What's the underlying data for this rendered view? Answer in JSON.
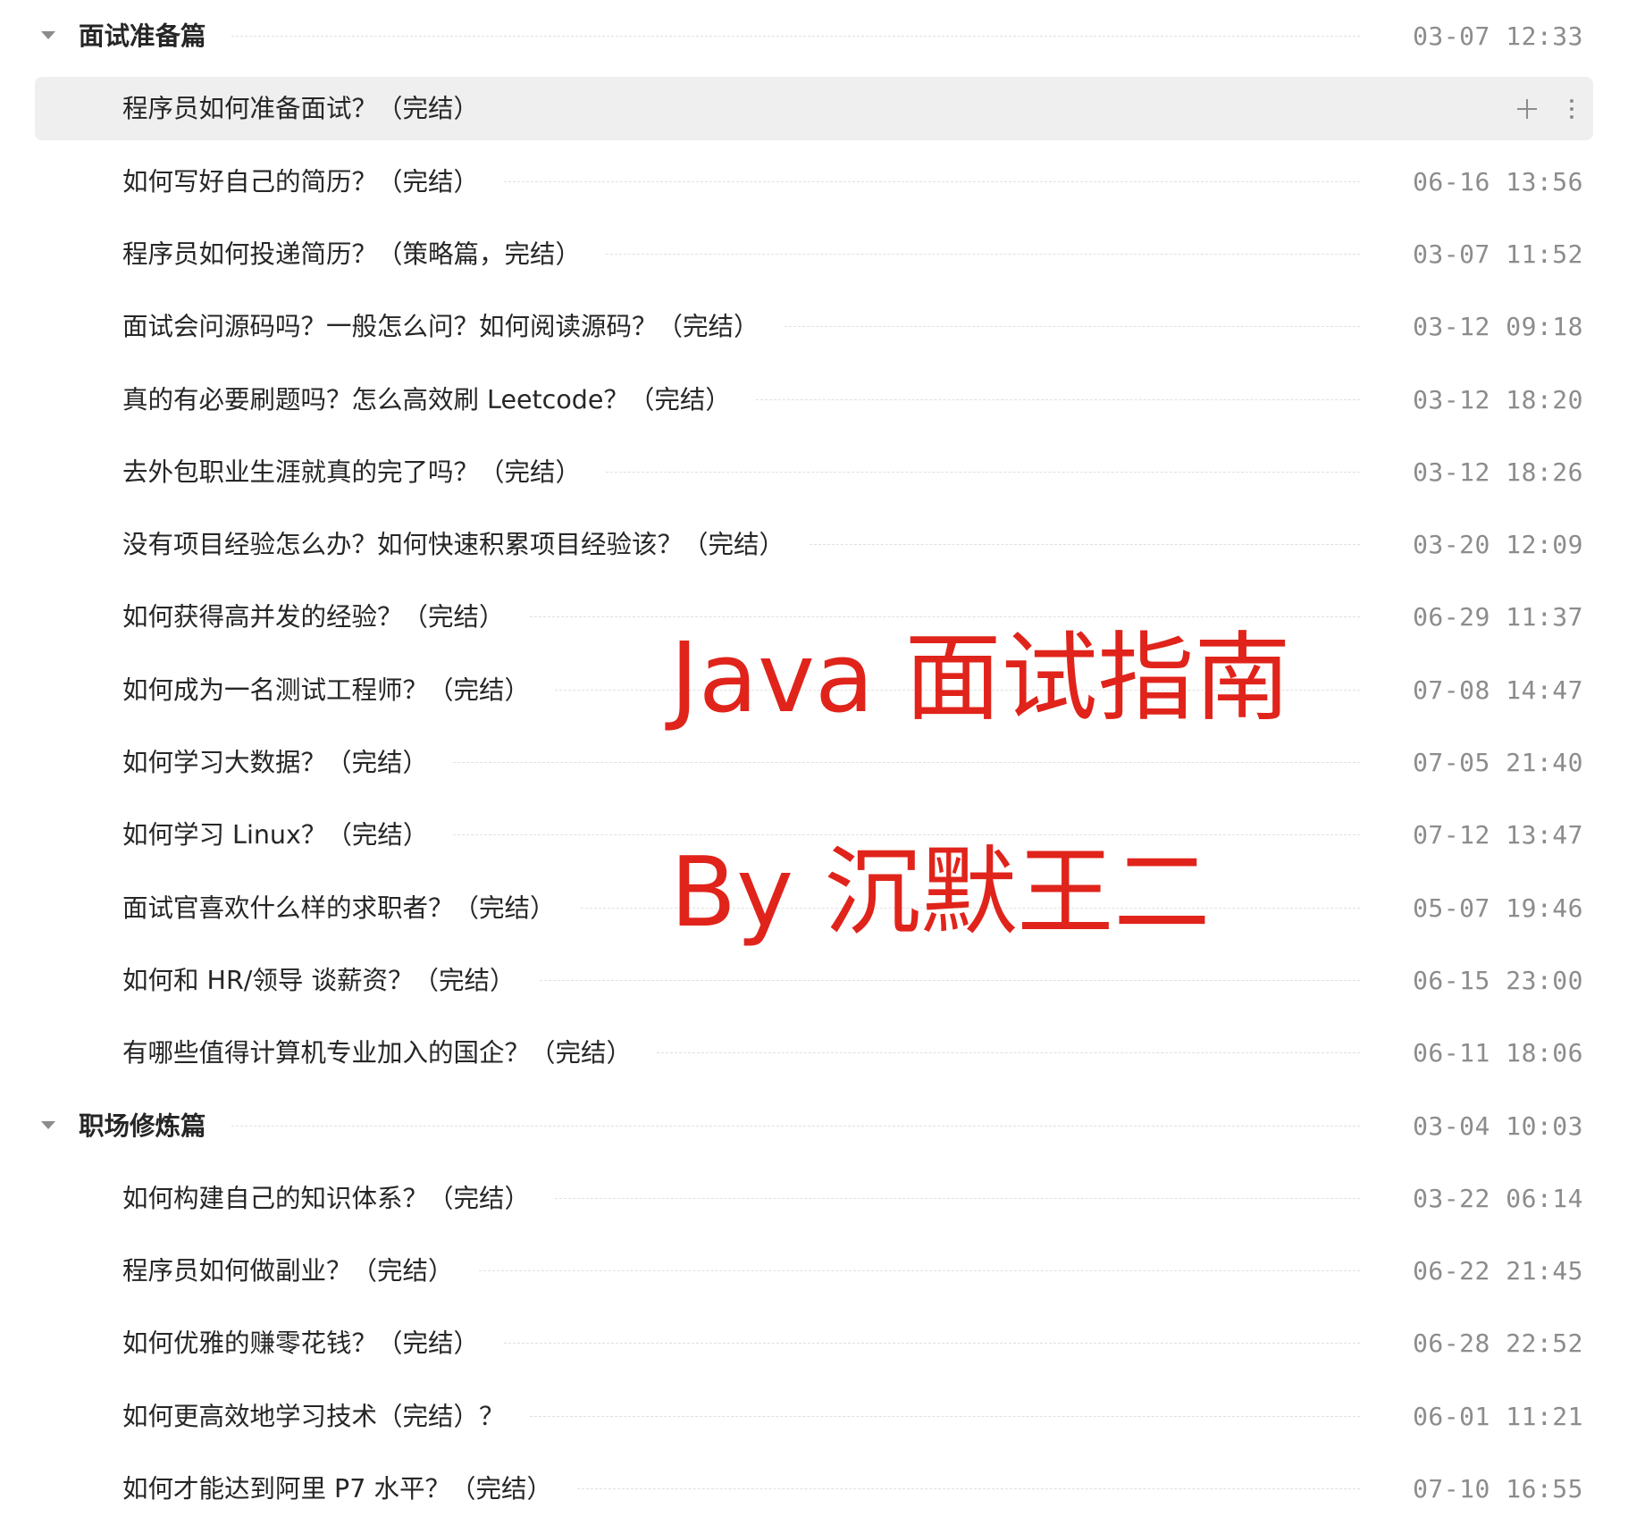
{
  "rows": [
    {
      "type": "section",
      "title": "面试准备篇",
      "date": "03-07 12:33"
    },
    {
      "type": "item",
      "title": "程序员如何准备面试？（完结）",
      "date": "",
      "highlight": true
    },
    {
      "type": "item",
      "title": "如何写好自己的简历？（完结）",
      "date": "06-16 13:56"
    },
    {
      "type": "item",
      "title": "程序员如何投递简历？（策略篇，完结）",
      "date": "03-07 11:52"
    },
    {
      "type": "item",
      "title": "面试会问源码吗？一般怎么问？如何阅读源码？（完结）",
      "date": "03-12 09:18"
    },
    {
      "type": "item",
      "title": "真的有必要刷题吗？怎么高效刷 Leetcode？（完结）",
      "date": "03-12 18:20"
    },
    {
      "type": "item",
      "title": "去外包职业生涯就真的完了吗？（完结）",
      "date": "03-12 18:26"
    },
    {
      "type": "item",
      "title": "没有项目经验怎么办？如何快速积累项目经验该？（完结）",
      "date": "03-20 12:09"
    },
    {
      "type": "item",
      "title": "如何获得高并发的经验？（完结）",
      "date": "06-29 11:37"
    },
    {
      "type": "item",
      "title": "如何成为一名测试工程师？（完结）",
      "date": "07-08 14:47"
    },
    {
      "type": "item",
      "title": "如何学习大数据？（完结）",
      "date": "07-05 21:40"
    },
    {
      "type": "item",
      "title": "如何学习 Linux？（完结）",
      "date": "07-12 13:47"
    },
    {
      "type": "item",
      "title": "面试官喜欢什么样的求职者？（完结）",
      "date": "05-07 19:46"
    },
    {
      "type": "item",
      "title": "如何和 HR/领导 谈薪资？（完结）",
      "date": "06-15 23:00"
    },
    {
      "type": "item",
      "title": "有哪些值得计算机专业加入的国企？（完结）",
      "date": "06-11 18:06"
    },
    {
      "type": "section",
      "title": "职场修炼篇",
      "date": "03-04 10:03"
    },
    {
      "type": "item",
      "title": "如何构建自己的知识体系？（完结）",
      "date": "03-22 06:14"
    },
    {
      "type": "item",
      "title": "程序员如何做副业？（完结）",
      "date": "06-22 21:45"
    },
    {
      "type": "item",
      "title": "如何优雅的赚零花钱？（完结）",
      "date": "06-28 22:52"
    },
    {
      "type": "item",
      "title": "如何更高效地学习技术（完结）？",
      "date": "06-01 11:21"
    },
    {
      "type": "item",
      "title": "如何才能达到阿里 P7 水平？（完结）",
      "date": "07-10 16:55"
    }
  ],
  "watermark": {
    "line1": "Java 面试指南",
    "line2": "By 沉默王二"
  }
}
